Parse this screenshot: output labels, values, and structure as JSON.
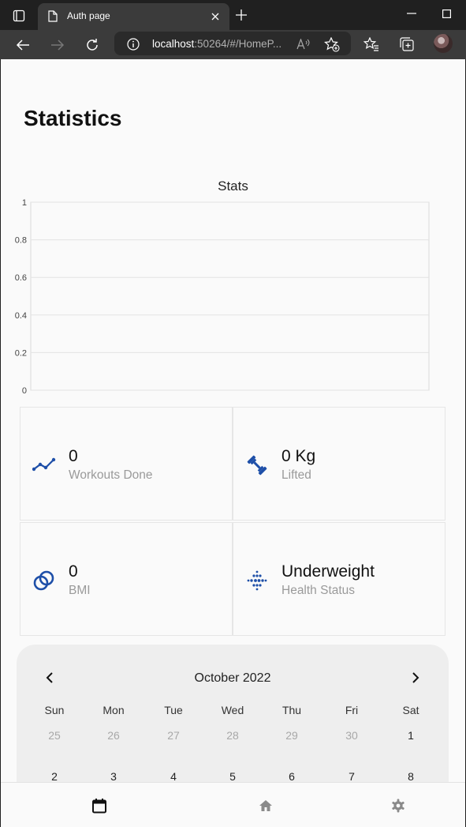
{
  "browser": {
    "tab_title": "Auth page",
    "url_host": "localhost",
    "url_rest": ":50264/#/HomeP..."
  },
  "page": {
    "title": "Statistics"
  },
  "chart_data": {
    "type": "line",
    "title": "Stats",
    "xlabel": "",
    "ylabel": "",
    "ylim": [
      0,
      1
    ],
    "yticks": [
      "0",
      "0.2",
      "0.4",
      "0.6",
      "0.8",
      "1"
    ],
    "series": [],
    "grid": true
  },
  "stats": [
    {
      "icon": "trend-line-icon",
      "value": "0",
      "label": "Workouts Done"
    },
    {
      "icon": "dumbbell-icon",
      "value": "0 Kg",
      "label": "Lifted"
    },
    {
      "icon": "rings-icon",
      "value": "0",
      "label": "BMI"
    },
    {
      "icon": "dotted-diamond-icon",
      "value": "Underweight",
      "label": "Health Status"
    }
  ],
  "calendar": {
    "month": "October 2022",
    "weekdays": [
      "Sun",
      "Mon",
      "Tue",
      "Wed",
      "Thu",
      "Fri",
      "Sat"
    ],
    "week1": [
      "25",
      "26",
      "27",
      "28",
      "29",
      "30",
      "1"
    ],
    "week2": [
      "2",
      "3",
      "4",
      "5",
      "6",
      "7",
      "8"
    ]
  },
  "colors": {
    "accent": "#1e4fa8",
    "chrome_dark": "#202020",
    "chrome_tab": "#3b3b3b",
    "page_bg": "#fafafa",
    "calendar_bg": "#eeeeee"
  }
}
